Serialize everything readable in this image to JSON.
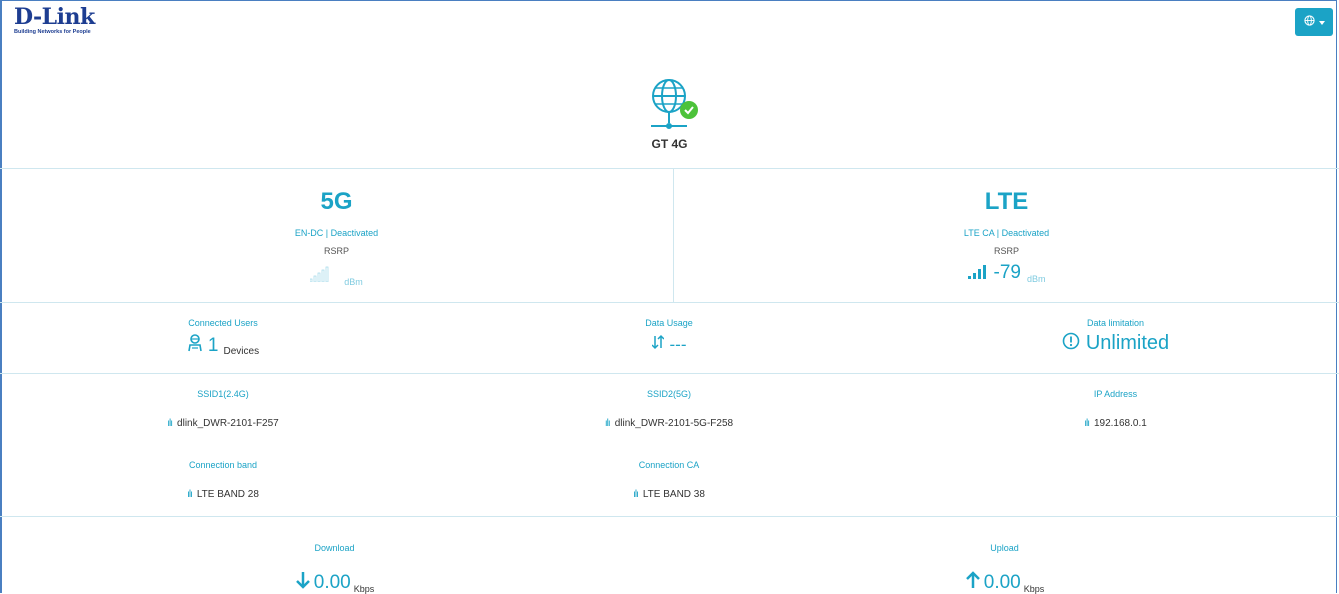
{
  "brand": {
    "name": "D-Link",
    "tagline": "Building Networks for People"
  },
  "header": {
    "lang_icon": "globe-icon"
  },
  "device": {
    "name": "GT 4G",
    "icon": "globe-network-icon",
    "status": "connected"
  },
  "radio_5g": {
    "tech": "5G",
    "status": "EN-DC | Deactivated",
    "rsrp_label": "RSRP",
    "rsrp_value": "",
    "unit": "dBm",
    "signal_bars": 0
  },
  "radio_lte": {
    "tech": "LTE",
    "status": "LTE CA | Deactivated",
    "rsrp_label": "RSRP",
    "rsrp_value": "-79",
    "unit": "dBm",
    "signal_bars": 4
  },
  "stats": {
    "connected_users": {
      "label": "Connected Users",
      "value": "1",
      "unit": "Devices"
    },
    "data_usage": {
      "label": "Data Usage",
      "value": "---"
    },
    "data_limitation": {
      "label": "Data limitation",
      "value": "Unlimited"
    }
  },
  "info": {
    "ssid1": {
      "label": "SSID1(2.4G)",
      "value": "dlink_DWR-2101-F257"
    },
    "ssid2": {
      "label": "SSID2(5G)",
      "value": "dlink_DWR-2101-5G-F258"
    },
    "ip": {
      "label": "IP Address",
      "value": "192.168.0.1"
    },
    "band": {
      "label": "Connection band",
      "value": "LTE BAND 28"
    },
    "ca": {
      "label": "Connection CA",
      "value": "LTE BAND 38"
    }
  },
  "throughput": {
    "download": {
      "label": "Download",
      "value": "0.00",
      "unit": "Kbps"
    },
    "upload": {
      "label": "Upload",
      "value": "0.00",
      "unit": "Kbps"
    }
  },
  "colors": {
    "accent": "#1ba3c6",
    "brand": "#1d3d91",
    "ok": "#4cc23a"
  }
}
